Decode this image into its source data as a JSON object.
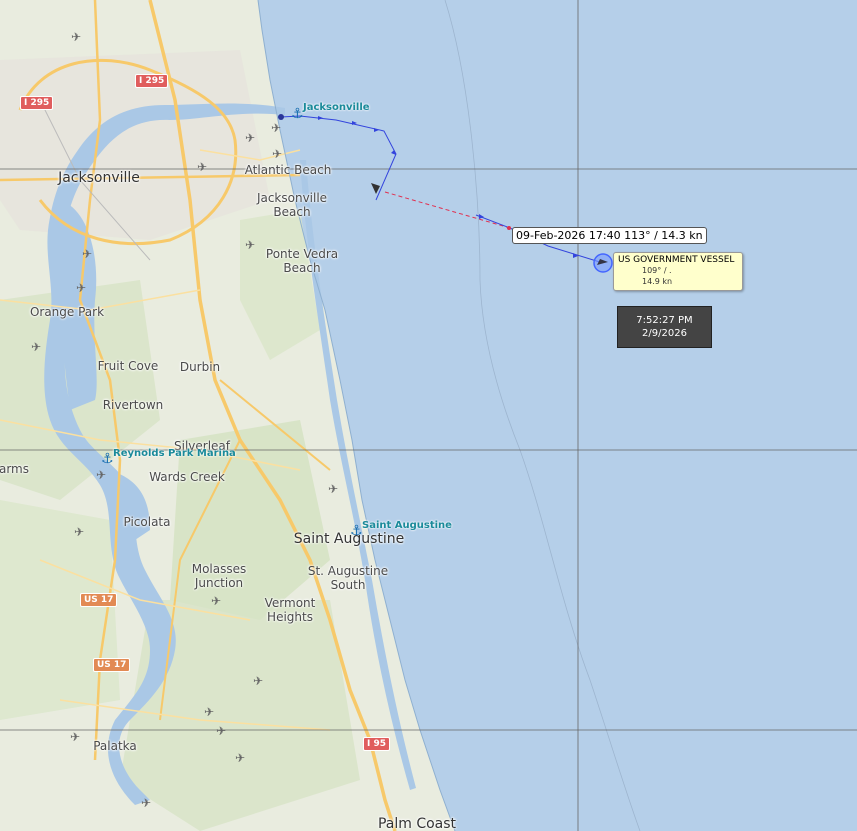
{
  "map": {
    "places": [
      {
        "name": "Jacksonville",
        "big": true
      },
      {
        "name": "Atlantic Beach"
      },
      {
        "name": "Jacksonville\nBeach"
      },
      {
        "name": "Ponte Vedra\nBeach"
      },
      {
        "name": "Orange Park"
      },
      {
        "name": "Fruit Cove"
      },
      {
        "name": "Durbin"
      },
      {
        "name": "Rivertown"
      },
      {
        "name": "Silverleaf"
      },
      {
        "name": "Wards Creek"
      },
      {
        "name": "arms"
      },
      {
        "name": "Picolata"
      },
      {
        "name": "Saint Augustine",
        "big": true
      },
      {
        "name": "St. Augustine\nSouth"
      },
      {
        "name": "Molasses\nJunction"
      },
      {
        "name": "Vermont\nHeights"
      },
      {
        "name": "Palatka"
      },
      {
        "name": "Palm Coast",
        "big": true
      }
    ],
    "shields": [
      {
        "text": "I 295",
        "kind": "i"
      },
      {
        "text": "I 295",
        "kind": "i"
      },
      {
        "text": "US 17",
        "kind": "us"
      },
      {
        "text": "US 17",
        "kind": "us"
      },
      {
        "text": "I 95",
        "kind": "i"
      }
    ],
    "ports": [
      {
        "name": "Jacksonville"
      },
      {
        "name": "Reynolds Park Marina"
      },
      {
        "name": "Saint Augustine"
      }
    ]
  },
  "track": {
    "position_label": "09-Feb-2026 17:40  113° / 14.3 kn"
  },
  "vessel": {
    "name": "US GOVERNMENT VESSEL",
    "course": "109° / .",
    "speed": "14.9 kn"
  },
  "clock": {
    "time": "7:52:27 PM",
    "date": "2/9/2026"
  },
  "colors": {
    "sea": "#b5cfe9",
    "land": "#e9ecdf",
    "track": "#3344dd",
    "gap": "#e03050",
    "vessel_marker": "#4466ff"
  }
}
